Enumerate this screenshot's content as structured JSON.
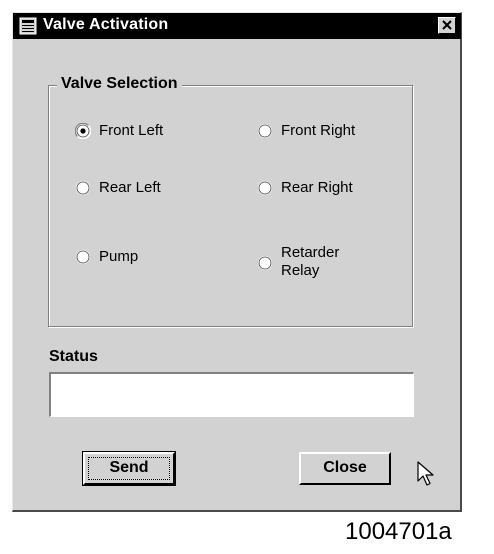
{
  "window": {
    "title": "Valve Activation",
    "icon": "app-window-icon",
    "close_icon": "close-x-icon"
  },
  "valve_selection": {
    "legend": "Valve Selection",
    "options": [
      {
        "label": "Front Left",
        "selected": true
      },
      {
        "label": "Front Right",
        "selected": false
      },
      {
        "label": "Rear Left",
        "selected": false
      },
      {
        "label": "Rear Right",
        "selected": false
      },
      {
        "label": "Pump",
        "selected": false
      },
      {
        "label": "Retarder Relay",
        "selected": false
      }
    ]
  },
  "status": {
    "label": "Status",
    "value": ""
  },
  "buttons": {
    "send": "Send",
    "close": "Close"
  },
  "figure_caption": "1004701a",
  "colors": {
    "dialog_face": "#d2d2d2",
    "titlebar": "#000000",
    "field": "#ffffff"
  }
}
